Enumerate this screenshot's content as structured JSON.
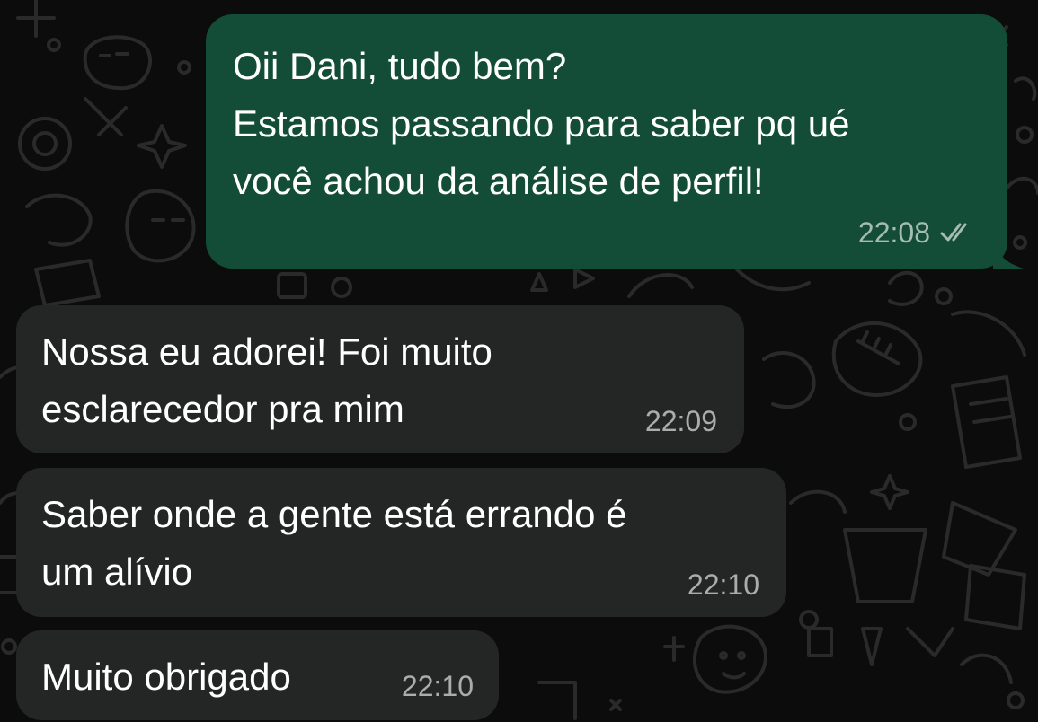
{
  "messages": [
    {
      "direction": "outgoing",
      "text": "Oii Dani, tudo bem?\nEstamos passando para saber pq ué\nvocê achou da análise de perfil!",
      "time": "22:08",
      "status_icon": "double-check-icon"
    },
    {
      "direction": "incoming",
      "text": "Nossa eu adorei! Foi muito\nesclarecedor pra mim",
      "time": "22:09"
    },
    {
      "direction": "incoming",
      "text": "Saber onde a gente está errando é\num alívio",
      "time": "22:10"
    },
    {
      "direction": "incoming",
      "text": "Muito obrigado",
      "time": "22:10"
    }
  ],
  "colors": {
    "background": "#0c0c0c",
    "outgoing_bubble": "#134d37",
    "incoming_bubble": "#242626",
    "text": "#ffffff"
  }
}
